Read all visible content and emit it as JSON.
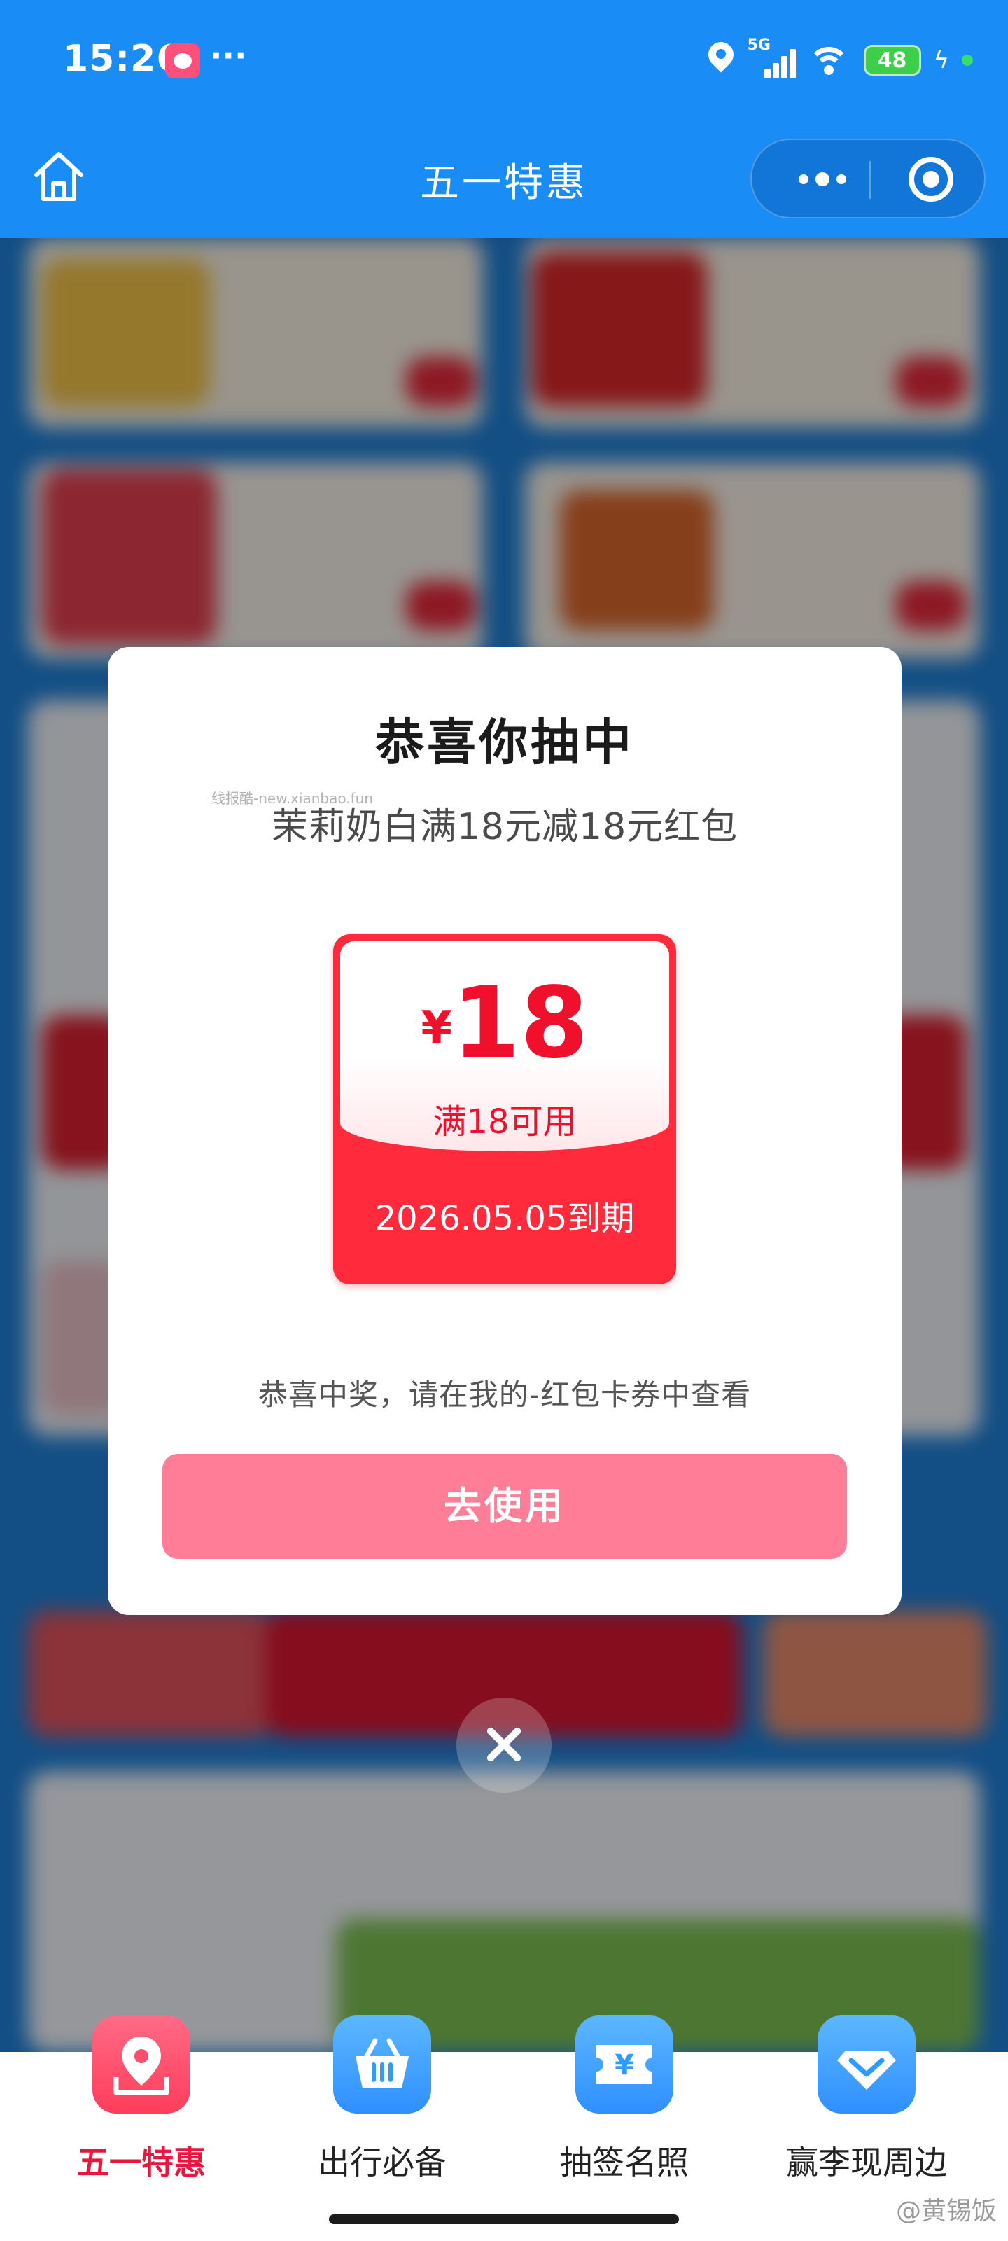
{
  "status_bar": {
    "time": "15:26",
    "more": "···",
    "network": "5G",
    "battery": "48"
  },
  "header": {
    "title": "五一特惠"
  },
  "modal": {
    "title": "恭喜你抽中",
    "watermark": "线报酷-new.xianbao.fun",
    "subtitle": "茉莉奶白满18元减18元红包",
    "coupon": {
      "currency": "¥",
      "amount": "18",
      "condition": "满18可用",
      "expire": "2026.05.05到期"
    },
    "hint": "恭喜中奖，请在我的-红包卡券中查看",
    "button": "去使用"
  },
  "bottom_nav": {
    "items": [
      {
        "label": "五一特惠",
        "icon": "map-pin-icon",
        "color": "#ff4d6d",
        "active": true
      },
      {
        "label": "出行必备",
        "icon": "basket-icon",
        "color": "#2f9bff",
        "active": false
      },
      {
        "label": "抽签名照",
        "icon": "ticket-icon",
        "color": "#2f9bff",
        "active": false
      },
      {
        "label": "赢李现周边",
        "icon": "diamond-icon",
        "color": "#2f9bff",
        "active": false
      }
    ]
  },
  "credit": "@黄锡饭",
  "colors": {
    "header_bg": "#1a8cf6",
    "coupon_red": "#ff2a3b",
    "button_pink": "#ff7d96",
    "active_tab": "#e8173d"
  }
}
